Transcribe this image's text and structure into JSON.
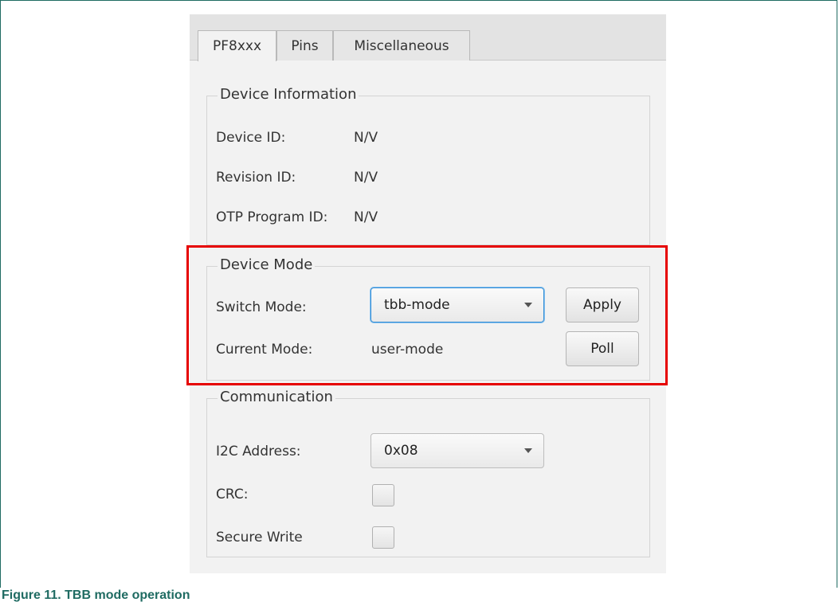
{
  "tabs": [
    {
      "label": "PF8xxx"
    },
    {
      "label": "Pins"
    },
    {
      "label": "Miscellaneous"
    }
  ],
  "device_information": {
    "title": "Device Information",
    "device_id_label": "Device ID:",
    "device_id_value": "N/V",
    "revision_id_label": "Revision ID:",
    "revision_id_value": "N/V",
    "otp_label": "OTP Program ID:",
    "otp_value": "N/V"
  },
  "device_mode": {
    "title": "Device Mode",
    "switch_mode_label": "Switch Mode:",
    "switch_mode_value": "tbb-mode",
    "apply_label": "Apply",
    "current_mode_label": "Current Mode:",
    "current_mode_value": "user-mode",
    "poll_label": "Poll"
  },
  "communication": {
    "title": "Communication",
    "i2c_label": "I2C Address:",
    "i2c_value": "0x08",
    "crc_label": "CRC:",
    "crc_checked": false,
    "secure_write_label": "Secure Write",
    "secure_write_checked": false
  },
  "caption": "Figure 11.  TBB mode operation",
  "colors": {
    "highlight": "#e60000",
    "caption": "#1f6b62",
    "focus": "#2e8bd6"
  }
}
